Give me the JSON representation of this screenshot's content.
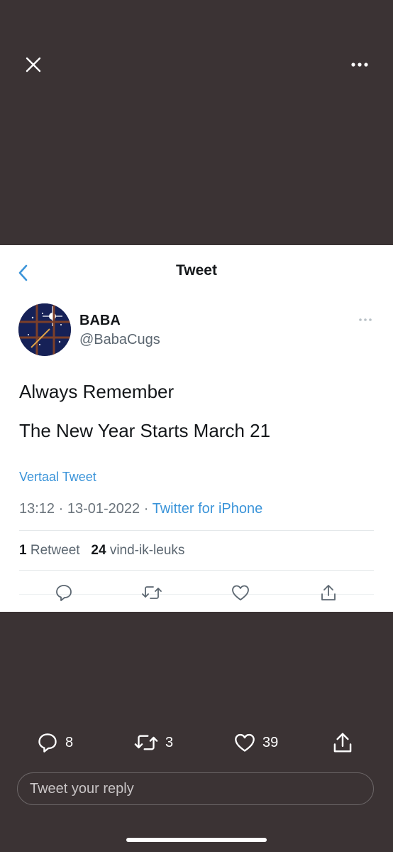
{
  "viewer": {
    "close_icon": "close-icon",
    "more_icon": "more-horizontal-icon"
  },
  "card": {
    "title": "Tweet",
    "back_icon": "chevron-left-icon",
    "author": {
      "name": "BABA",
      "handle": "@BabaCugs"
    },
    "text_lines": [
      "Always Remember",
      "The New Year Starts March 21"
    ],
    "translate_label": "Vertaal Tweet",
    "time": "13:12",
    "date": "13-01-2022",
    "source": "Twitter for iPhone",
    "separator": "·",
    "stats": {
      "retweets_count": "1",
      "retweets_label": "Retweet",
      "likes_count": "24",
      "likes_label": "vind-ik-leuks"
    },
    "colors": {
      "link": "#3b94d9",
      "text": "#14171a",
      "muted": "#5b6670"
    }
  },
  "bottom_bar": {
    "reply_count": "8",
    "retweet_count": "3",
    "like_count": "39",
    "reply_placeholder": "Tweet your reply"
  },
  "colors": {
    "background": "#3b3334",
    "card": "#ffffff"
  }
}
